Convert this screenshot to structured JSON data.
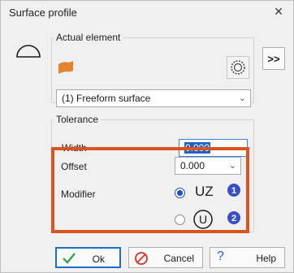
{
  "window": {
    "title": "Surface profile",
    "close_label": "×"
  },
  "icons": {
    "profile": "surface-profile-symbol-icon",
    "freeform": "freeform-surface-icon",
    "selection": "element-select-icon",
    "ok": "checkmark-icon",
    "cancel": "cancel-circle-icon",
    "help": "question-mark-icon"
  },
  "actual_element": {
    "legend": "Actual element",
    "element_value": "(1) Freeform surface",
    "more_label": ">>"
  },
  "tolerance": {
    "legend": "Tolerance",
    "width_label": "Width",
    "width_value": "0.000",
    "offset_label": "Offset",
    "offset_value": "0.000",
    "modifier_label": "Modifier",
    "modifier_options": [
      {
        "text": "UZ",
        "badge": "1",
        "selected": true
      },
      {
        "text": "U",
        "badge": "2",
        "selected": false
      }
    ]
  },
  "buttons": {
    "ok": "Ok",
    "cancel": "Cancel",
    "help": "Help"
  },
  "colors": {
    "highlight": "#d9541e",
    "selected_text_bg": "#1f60c9",
    "badge": "#3b4fc4",
    "freeform": "#e5842f"
  }
}
